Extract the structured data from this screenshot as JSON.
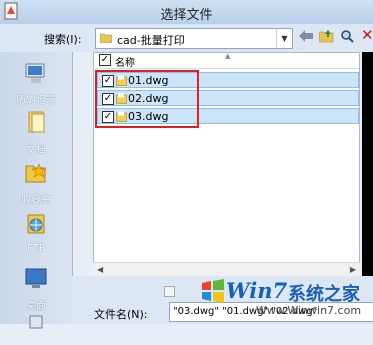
{
  "window": {
    "title": "选择文件"
  },
  "lookin": {
    "label": "搜索(I):",
    "folder": "cad-批量打印"
  },
  "places": [
    {
      "label": "历史记录",
      "icon": "history-icon"
    },
    {
      "label": "文档",
      "icon": "documents-icon"
    },
    {
      "label": "收藏夹",
      "icon": "favorites-icon"
    },
    {
      "label": "FTP",
      "icon": "ftp-icon"
    },
    {
      "label": "桌面",
      "icon": "desktop-icon"
    }
  ],
  "list": {
    "header": "名称",
    "files": [
      {
        "name": "01.dwg",
        "checked": true
      },
      {
        "name": "02.dwg",
        "checked": true
      },
      {
        "name": "03.dwg",
        "checked": true
      }
    ]
  },
  "bottom": {
    "filename_label": "文件名(N):",
    "filename_value": "\"03.dwg\" \"01.dwg\" \"02.dwg\""
  },
  "watermark": {
    "brand": "Win7",
    "suffix": "系统之家",
    "url": "Www.Winwin7.com"
  },
  "colors": {
    "selection": "#cce4f7",
    "highlight_box": "#e02020",
    "accent": "#1561b8"
  }
}
